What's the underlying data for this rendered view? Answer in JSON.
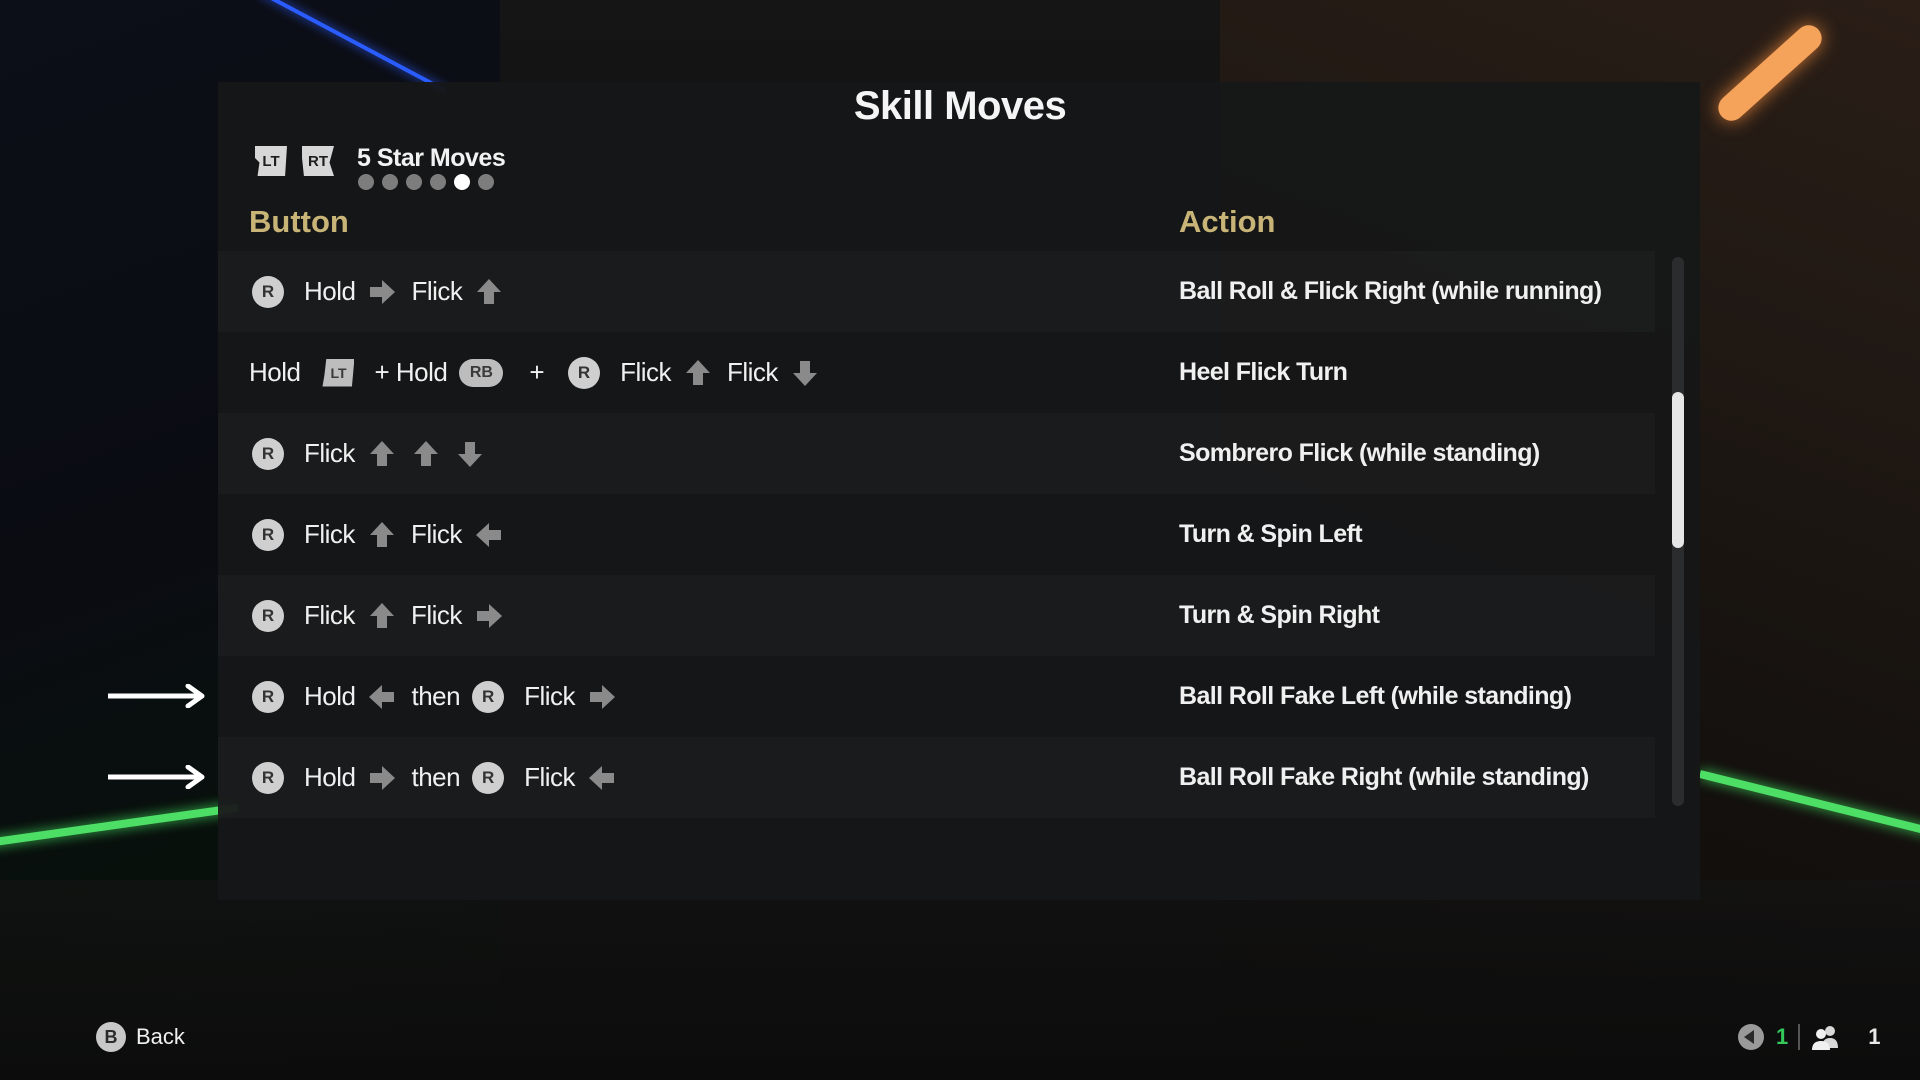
{
  "screen": {
    "title": "Skill Moves",
    "page_tabs": {
      "prev_trigger": "LT",
      "next_trigger": "RT",
      "current_label": "5 Star Moves",
      "page_count": 6,
      "active_page_index": 4
    }
  },
  "columns": {
    "button": "Button",
    "action": "Action"
  },
  "rows": [
    {
      "combo": [
        {
          "type": "stick",
          "label": "R"
        },
        {
          "type": "word",
          "text": "Hold"
        },
        {
          "type": "arrow",
          "dir": "right"
        },
        {
          "type": "word",
          "text": "Flick"
        },
        {
          "type": "arrow",
          "dir": "up"
        }
      ],
      "action": "Ball Roll & Flick Right (while running)",
      "highlighted": false
    },
    {
      "combo": [
        {
          "type": "word",
          "text": "Hold"
        },
        {
          "type": "trigger",
          "label": "LT"
        },
        {
          "type": "word",
          "text": "+ Hold"
        },
        {
          "type": "bumper",
          "label": "RB"
        },
        {
          "type": "word",
          "text": "+"
        },
        {
          "type": "stick",
          "label": "R"
        },
        {
          "type": "word",
          "text": "Flick"
        },
        {
          "type": "arrow",
          "dir": "up"
        },
        {
          "type": "word",
          "text": "Flick"
        },
        {
          "type": "arrow",
          "dir": "down"
        }
      ],
      "action": "Heel Flick Turn",
      "highlighted": false
    },
    {
      "combo": [
        {
          "type": "stick",
          "label": "R"
        },
        {
          "type": "word",
          "text": "Flick"
        },
        {
          "type": "arrow",
          "dir": "up"
        },
        {
          "type": "arrow",
          "dir": "up"
        },
        {
          "type": "arrow",
          "dir": "down"
        }
      ],
      "action": "Sombrero Flick (while standing)",
      "highlighted": false
    },
    {
      "combo": [
        {
          "type": "stick",
          "label": "R"
        },
        {
          "type": "word",
          "text": "Flick"
        },
        {
          "type": "arrow",
          "dir": "up"
        },
        {
          "type": "word",
          "text": "Flick"
        },
        {
          "type": "arrow",
          "dir": "left"
        }
      ],
      "action": "Turn & Spin Left",
      "highlighted": false
    },
    {
      "combo": [
        {
          "type": "stick",
          "label": "R"
        },
        {
          "type": "word",
          "text": "Flick"
        },
        {
          "type": "arrow",
          "dir": "up"
        },
        {
          "type": "word",
          "text": "Flick"
        },
        {
          "type": "arrow",
          "dir": "right"
        }
      ],
      "action": "Turn & Spin Right",
      "highlighted": false
    },
    {
      "combo": [
        {
          "type": "stick",
          "label": "R"
        },
        {
          "type": "word",
          "text": "Hold"
        },
        {
          "type": "arrow",
          "dir": "left"
        },
        {
          "type": "word",
          "text": "then"
        },
        {
          "type": "stick",
          "label": "R"
        },
        {
          "type": "word",
          "text": "Flick"
        },
        {
          "type": "arrow",
          "dir": "right"
        }
      ],
      "action": "Ball Roll Fake Left (while standing)",
      "highlighted": true
    },
    {
      "combo": [
        {
          "type": "stick",
          "label": "R"
        },
        {
          "type": "word",
          "text": "Hold"
        },
        {
          "type": "arrow",
          "dir": "right"
        },
        {
          "type": "word",
          "text": "then"
        },
        {
          "type": "stick",
          "label": "R"
        },
        {
          "type": "word",
          "text": "Flick"
        },
        {
          "type": "arrow",
          "dir": "left"
        }
      ],
      "action": "Ball Roll Fake Right (while standing)",
      "highlighted": true
    }
  ],
  "scrollbar": {
    "thumb_start_fraction": 0.246,
    "thumb_size_fraction": 0.284
  },
  "footer": {
    "back_button_glyph": "B",
    "back_label": "Back",
    "voice_icon": "speaker-icon",
    "voice_count": "1",
    "players_icon": "players-icon",
    "players_count": "1"
  },
  "colors": {
    "header_gold": "#c9b477",
    "active_green": "#34c759",
    "panel_bg": "#161718"
  }
}
